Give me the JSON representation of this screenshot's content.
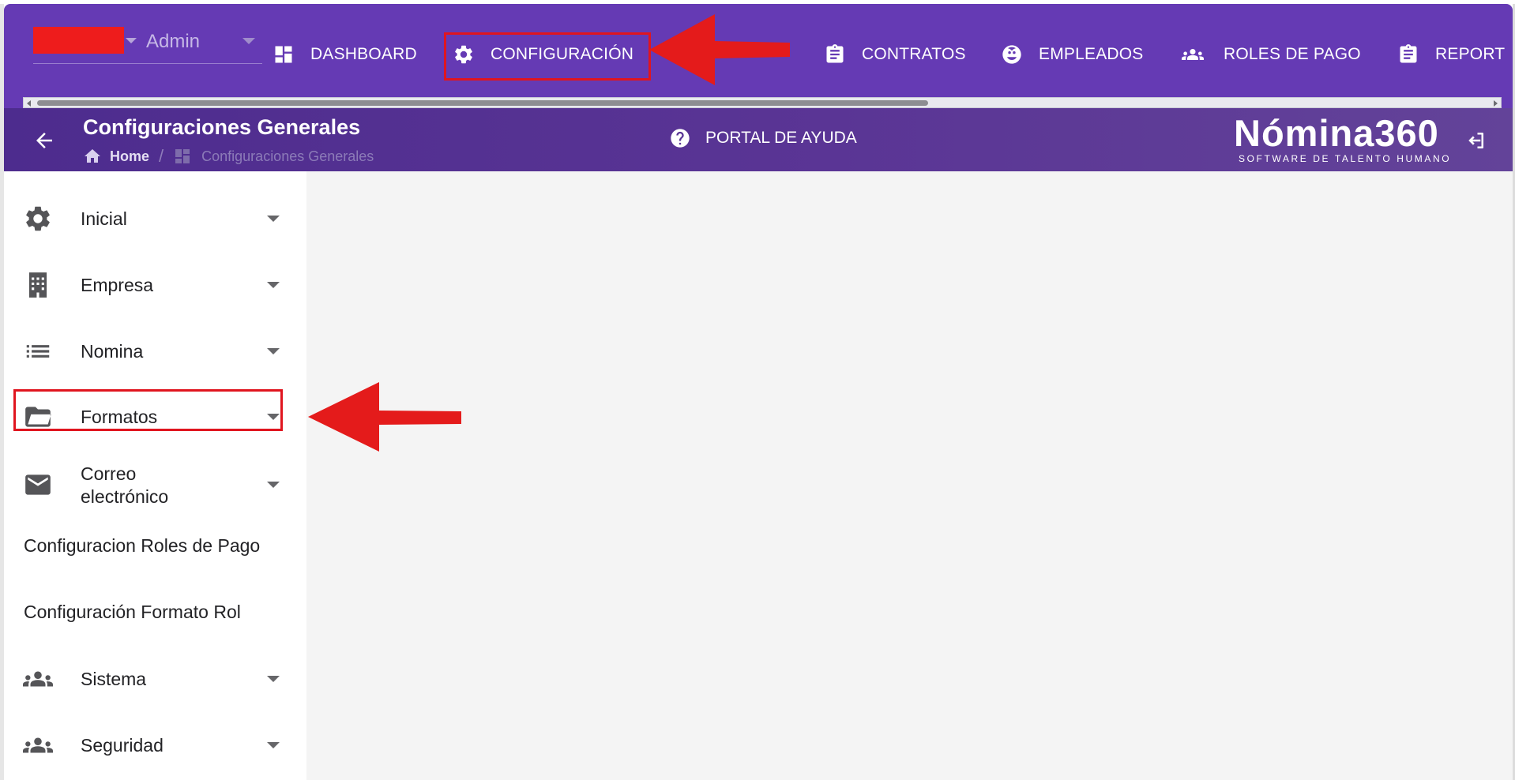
{
  "topbar": {
    "company_selector": {
      "user": "Admin"
    },
    "nav": [
      {
        "label": "DASHBOARD",
        "icon": "dashboard-icon"
      },
      {
        "label": "CONFIGURACIÓN",
        "icon": "gear-icon"
      },
      {
        "label": "CONTRATOS",
        "icon": "clipboard-icon"
      },
      {
        "label": "EMPLEADOS",
        "icon": "face-icon"
      },
      {
        "label": "ROLES DE PAGO",
        "icon": "group-icon"
      },
      {
        "label": "REPORT",
        "icon": "clipboard-icon"
      }
    ]
  },
  "header": {
    "title": "Configuraciones Generales",
    "breadcrumb": {
      "home": "Home",
      "separator": "/",
      "current": "Configuraciones Generales"
    },
    "help_label": "PORTAL DE AYUDA",
    "logo": {
      "wordmark": "Nómina360",
      "tagline": "SOFTWARE DE TALENTO HUMANO"
    }
  },
  "sidebar": {
    "items": [
      {
        "label": "Inicial",
        "icon": "gear-icon"
      },
      {
        "label": "Empresa",
        "icon": "building-icon"
      },
      {
        "label": "Nomina",
        "icon": "list-icon"
      },
      {
        "label": "Formatos",
        "icon": "folder-open-icon"
      },
      {
        "label": "Correo electrónico",
        "line1": "Correo",
        "line2": "electrónico",
        "icon": "mail-icon"
      },
      {
        "label": "Configuracion Roles de Pago"
      },
      {
        "label": "Configuración Formato Rol"
      },
      {
        "label": "Sistema",
        "icon": "group-icon"
      },
      {
        "label": "Seguridad",
        "icon": "group-icon"
      }
    ]
  },
  "colors": {
    "topbar": "#653ab4",
    "header": "#5a3595",
    "annotation": "#e0151f",
    "content_bg": "#f4f4f4"
  }
}
